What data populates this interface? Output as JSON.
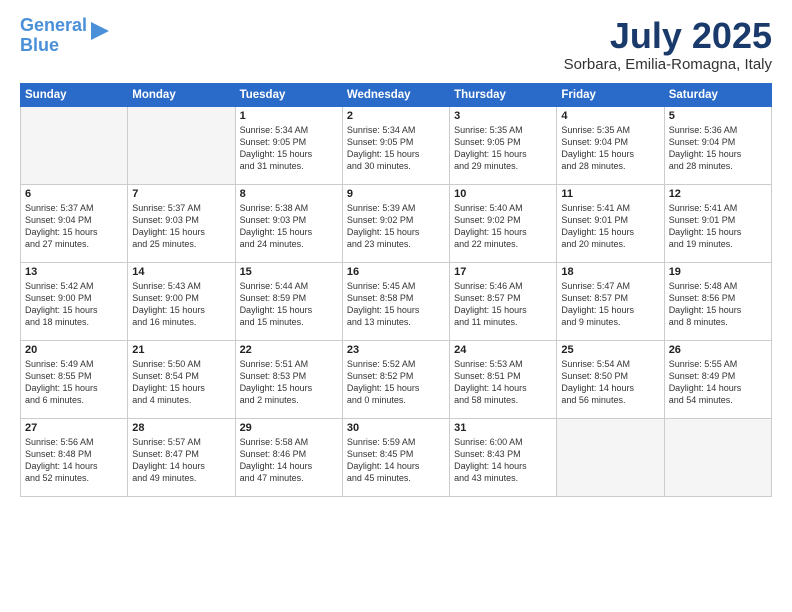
{
  "logo": {
    "line1": "General",
    "line2": "Blue"
  },
  "title": "July 2025",
  "location": "Sorbara, Emilia-Romagna, Italy",
  "headers": [
    "Sunday",
    "Monday",
    "Tuesday",
    "Wednesday",
    "Thursday",
    "Friday",
    "Saturday"
  ],
  "weeks": [
    [
      {
        "day": "",
        "info": ""
      },
      {
        "day": "",
        "info": ""
      },
      {
        "day": "1",
        "info": "Sunrise: 5:34 AM\nSunset: 9:05 PM\nDaylight: 15 hours\nand 31 minutes."
      },
      {
        "day": "2",
        "info": "Sunrise: 5:34 AM\nSunset: 9:05 PM\nDaylight: 15 hours\nand 30 minutes."
      },
      {
        "day": "3",
        "info": "Sunrise: 5:35 AM\nSunset: 9:05 PM\nDaylight: 15 hours\nand 29 minutes."
      },
      {
        "day": "4",
        "info": "Sunrise: 5:35 AM\nSunset: 9:04 PM\nDaylight: 15 hours\nand 28 minutes."
      },
      {
        "day": "5",
        "info": "Sunrise: 5:36 AM\nSunset: 9:04 PM\nDaylight: 15 hours\nand 28 minutes."
      }
    ],
    [
      {
        "day": "6",
        "info": "Sunrise: 5:37 AM\nSunset: 9:04 PM\nDaylight: 15 hours\nand 27 minutes."
      },
      {
        "day": "7",
        "info": "Sunrise: 5:37 AM\nSunset: 9:03 PM\nDaylight: 15 hours\nand 25 minutes."
      },
      {
        "day": "8",
        "info": "Sunrise: 5:38 AM\nSunset: 9:03 PM\nDaylight: 15 hours\nand 24 minutes."
      },
      {
        "day": "9",
        "info": "Sunrise: 5:39 AM\nSunset: 9:02 PM\nDaylight: 15 hours\nand 23 minutes."
      },
      {
        "day": "10",
        "info": "Sunrise: 5:40 AM\nSunset: 9:02 PM\nDaylight: 15 hours\nand 22 minutes."
      },
      {
        "day": "11",
        "info": "Sunrise: 5:41 AM\nSunset: 9:01 PM\nDaylight: 15 hours\nand 20 minutes."
      },
      {
        "day": "12",
        "info": "Sunrise: 5:41 AM\nSunset: 9:01 PM\nDaylight: 15 hours\nand 19 minutes."
      }
    ],
    [
      {
        "day": "13",
        "info": "Sunrise: 5:42 AM\nSunset: 9:00 PM\nDaylight: 15 hours\nand 18 minutes."
      },
      {
        "day": "14",
        "info": "Sunrise: 5:43 AM\nSunset: 9:00 PM\nDaylight: 15 hours\nand 16 minutes."
      },
      {
        "day": "15",
        "info": "Sunrise: 5:44 AM\nSunset: 8:59 PM\nDaylight: 15 hours\nand 15 minutes."
      },
      {
        "day": "16",
        "info": "Sunrise: 5:45 AM\nSunset: 8:58 PM\nDaylight: 15 hours\nand 13 minutes."
      },
      {
        "day": "17",
        "info": "Sunrise: 5:46 AM\nSunset: 8:57 PM\nDaylight: 15 hours\nand 11 minutes."
      },
      {
        "day": "18",
        "info": "Sunrise: 5:47 AM\nSunset: 8:57 PM\nDaylight: 15 hours\nand 9 minutes."
      },
      {
        "day": "19",
        "info": "Sunrise: 5:48 AM\nSunset: 8:56 PM\nDaylight: 15 hours\nand 8 minutes."
      }
    ],
    [
      {
        "day": "20",
        "info": "Sunrise: 5:49 AM\nSunset: 8:55 PM\nDaylight: 15 hours\nand 6 minutes."
      },
      {
        "day": "21",
        "info": "Sunrise: 5:50 AM\nSunset: 8:54 PM\nDaylight: 15 hours\nand 4 minutes."
      },
      {
        "day": "22",
        "info": "Sunrise: 5:51 AM\nSunset: 8:53 PM\nDaylight: 15 hours\nand 2 minutes."
      },
      {
        "day": "23",
        "info": "Sunrise: 5:52 AM\nSunset: 8:52 PM\nDaylight: 15 hours\nand 0 minutes."
      },
      {
        "day": "24",
        "info": "Sunrise: 5:53 AM\nSunset: 8:51 PM\nDaylight: 14 hours\nand 58 minutes."
      },
      {
        "day": "25",
        "info": "Sunrise: 5:54 AM\nSunset: 8:50 PM\nDaylight: 14 hours\nand 56 minutes."
      },
      {
        "day": "26",
        "info": "Sunrise: 5:55 AM\nSunset: 8:49 PM\nDaylight: 14 hours\nand 54 minutes."
      }
    ],
    [
      {
        "day": "27",
        "info": "Sunrise: 5:56 AM\nSunset: 8:48 PM\nDaylight: 14 hours\nand 52 minutes."
      },
      {
        "day": "28",
        "info": "Sunrise: 5:57 AM\nSunset: 8:47 PM\nDaylight: 14 hours\nand 49 minutes."
      },
      {
        "day": "29",
        "info": "Sunrise: 5:58 AM\nSunset: 8:46 PM\nDaylight: 14 hours\nand 47 minutes."
      },
      {
        "day": "30",
        "info": "Sunrise: 5:59 AM\nSunset: 8:45 PM\nDaylight: 14 hours\nand 45 minutes."
      },
      {
        "day": "31",
        "info": "Sunrise: 6:00 AM\nSunset: 8:43 PM\nDaylight: 14 hours\nand 43 minutes."
      },
      {
        "day": "",
        "info": ""
      },
      {
        "day": "",
        "info": ""
      }
    ]
  ]
}
